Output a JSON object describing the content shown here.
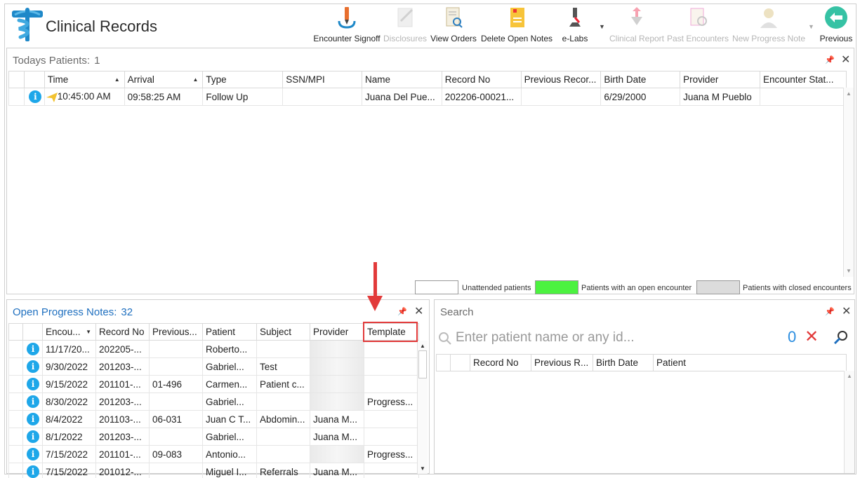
{
  "app": {
    "title": "Clinical Records"
  },
  "toolbar": [
    {
      "label": "Encounter Signoff",
      "icon": "signoff-pen-icon",
      "enabled": true
    },
    {
      "label": "Disclosures",
      "icon": "disclosures-icon",
      "enabled": false
    },
    {
      "label": "View Orders",
      "icon": "view-orders-icon",
      "enabled": true
    },
    {
      "label": "Delete Open Notes",
      "icon": "delete-notes-icon",
      "enabled": true
    },
    {
      "label": "e-Labs",
      "icon": "microscope-icon",
      "enabled": true
    },
    {
      "label": "Clinical Report",
      "icon": "clinical-report-icon",
      "enabled": false
    },
    {
      "label": "Past Encounters",
      "icon": "past-encounters-icon",
      "enabled": false
    },
    {
      "label": "New Progress Note",
      "icon": "new-progress-note-icon",
      "enabled": false
    },
    {
      "label": "Previous",
      "icon": "back-arrow-icon",
      "enabled": true
    }
  ],
  "todays_patients": {
    "title": "Todays Patients:",
    "count": "1",
    "columns": [
      "Time",
      "Arrival",
      "Type",
      "SSN/MPI",
      "Name",
      "Record No",
      "Previous Recor...",
      "Birth Date",
      "Provider",
      "Encounter Stat..."
    ],
    "rows": [
      {
        "Time": "10:45:00 AM",
        "Arrival": "09:58:25 AM",
        "Type": "Follow Up",
        "SSN/MPI": "",
        "Name": "Juana Del Pue...",
        "Record No": "202206-00021...",
        "Previous Recor...": "",
        "Birth Date": "6/29/2000",
        "Provider": "Juana M Pueblo",
        "Encounter Stat...": ""
      }
    ]
  },
  "legend": [
    {
      "label": "Unattended patients",
      "color": "#ffffff"
    },
    {
      "label": "Patients with an open encounter",
      "color": "#4cf240"
    },
    {
      "label": "Patients with closed encounters",
      "color": "#dcdcdc"
    }
  ],
  "open_notes": {
    "title": "Open Progress Notes:",
    "count": "32",
    "columns": [
      "Encou...",
      "Record No",
      "Previous...",
      "Patient",
      "Subject",
      "Provider",
      "Template"
    ],
    "rows": [
      {
        "enc": "11/17/20...",
        "rec": "202205-...",
        "prev": "",
        "patient": "Roberto...",
        "subject": "",
        "provider": "",
        "template": ""
      },
      {
        "enc": "9/30/2022",
        "rec": "201203-...",
        "prev": "",
        "patient": "Gabriel...",
        "subject": "Test",
        "provider": "",
        "template": ""
      },
      {
        "enc": "9/15/2022",
        "rec": "201101-...",
        "prev": "01-496",
        "patient": "Carmen...",
        "subject": "Patient c...",
        "provider": "",
        "template": ""
      },
      {
        "enc": "8/30/2022",
        "rec": "201203-...",
        "prev": "",
        "patient": "Gabriel...",
        "subject": "",
        "provider": "",
        "template": "Progress..."
      },
      {
        "enc": "8/4/2022",
        "rec": "201103-...",
        "prev": "06-031",
        "patient": "Juan C T...",
        "subject": "Abdomin...",
        "provider": "Juana M...",
        "template": ""
      },
      {
        "enc": "8/1/2022",
        "rec": "201203-...",
        "prev": "",
        "patient": "Gabriel...",
        "subject": "",
        "provider": "Juana M...",
        "template": ""
      },
      {
        "enc": "7/15/2022",
        "rec": "201101-...",
        "prev": "09-083",
        "patient": "Antonio...",
        "subject": "",
        "provider": "",
        "template": "Progress..."
      },
      {
        "enc": "7/15/2022",
        "rec": "201012-...",
        "prev": "",
        "patient": "Miguel I...",
        "subject": "Referrals",
        "provider": "Juana M...",
        "template": ""
      }
    ]
  },
  "search": {
    "title": "Search",
    "placeholder": "Enter patient name or any id...",
    "result_count": "0",
    "columns": [
      "Record No",
      "Previous R...",
      "Birth Date",
      "Patient"
    ]
  }
}
